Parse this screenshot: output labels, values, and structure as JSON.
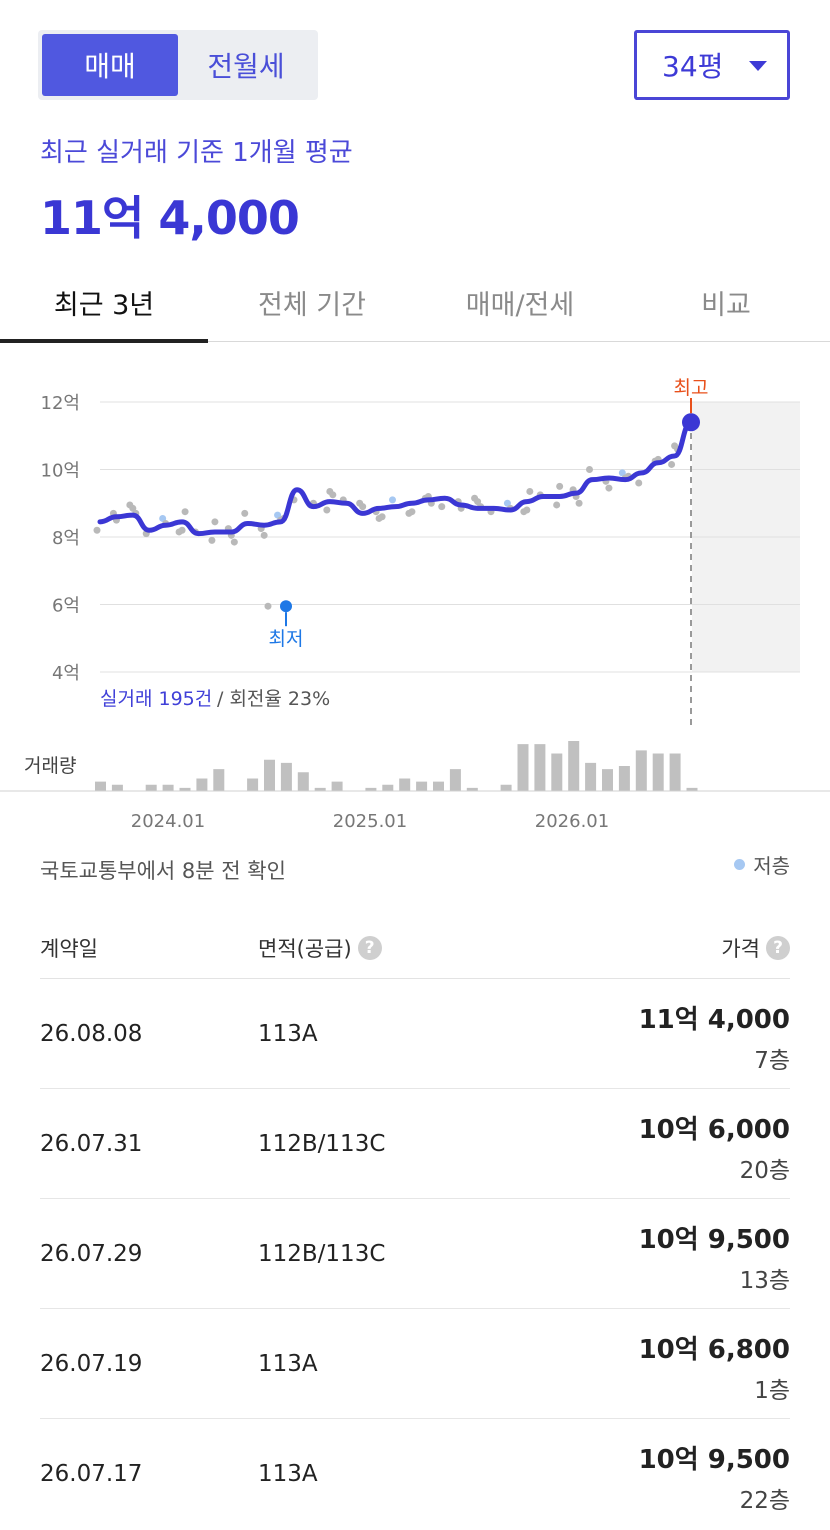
{
  "toggle": {
    "active": "매매",
    "inactive": "전월세"
  },
  "size_select": {
    "value": "34평"
  },
  "summary": {
    "subtitle": "최근 실거래 기준 1개월 평균",
    "price": "11억 4,000"
  },
  "tabs": [
    "최근 3년",
    "전체 기간",
    "매매/전세",
    "비교"
  ],
  "chart": {
    "y_ticks": [
      "12억",
      "10억",
      "8억",
      "6억",
      "4억"
    ],
    "x_ticks": [
      "2024.01",
      "2025.01",
      "2026.01"
    ],
    "max_label": "최고",
    "min_label": "최저",
    "trade_count": "실거래 195건",
    "turnover": " / 회전율 23%",
    "volume_label": "거래량",
    "legend_low": "저층",
    "colors": {
      "line": "#3b37d4",
      "max": "#e8501b",
      "min": "#1e78e6",
      "dot": "#b9b9b9",
      "low_dot": "#a6c8f2",
      "bar": "#c0c0c0"
    }
  },
  "chart_data": {
    "type": "line",
    "ylim": [
      4,
      12
    ],
    "yunit": "억",
    "series": [
      {
        "values": [
          8.45,
          8.6,
          8.65,
          8.2,
          8.35,
          8.45,
          8.1,
          8.15,
          8.15,
          8.4,
          8.35,
          8.45,
          9.4,
          8.9,
          9.05,
          9.0,
          8.7,
          8.85,
          8.9,
          9.0,
          9.1,
          9.15,
          8.95,
          8.85,
          8.85,
          8.8,
          9.05,
          9.2,
          9.2,
          9.3,
          9.7,
          9.75,
          9.7,
          9.9,
          10.2,
          10.4,
          11.4
        ]
      }
    ],
    "max": {
      "label": "최고",
      "value": 11.4
    },
    "min": {
      "label": "최저",
      "value": 5.95
    },
    "volume": [
      3,
      2,
      0,
      2,
      2,
      1,
      4,
      7,
      0,
      4,
      10,
      9,
      6,
      1,
      3,
      0,
      1,
      2,
      4,
      3,
      3,
      7,
      1,
      0,
      2,
      15,
      15,
      12,
      16,
      9,
      7,
      8,
      13,
      12,
      12,
      1
    ]
  },
  "source_text": "국토교통부에서 8분 전 확인",
  "table": {
    "headers": {
      "date": "계약일",
      "area": "면적(공급)",
      "price": "가격"
    },
    "rows": [
      {
        "date": "26.08.08",
        "area": "113A",
        "price": "11억 4,000",
        "floor": "7층"
      },
      {
        "date": "26.07.31",
        "area": "112B/113C",
        "price": "10억 6,000",
        "floor": "20층"
      },
      {
        "date": "26.07.29",
        "area": "112B/113C",
        "price": "10억 9,500",
        "floor": "13층"
      },
      {
        "date": "26.07.19",
        "area": "113A",
        "price": "10억 6,800",
        "floor": "1층"
      },
      {
        "date": "26.07.17",
        "area": "113A",
        "price": "10억 9,500",
        "floor": "22층"
      }
    ]
  }
}
